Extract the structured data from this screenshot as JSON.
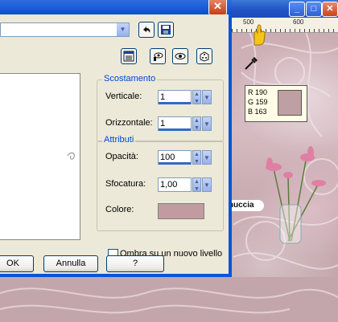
{
  "host": {
    "ruler_labels": [
      "500",
      "600"
    ],
    "color_readout": {
      "r": "R 190",
      "g": "G 159",
      "b": "B 163",
      "swatch": "#be9fa3"
    },
    "window_buttons": {
      "minimize": "_",
      "maximize": "□",
      "close": "✕"
    }
  },
  "dialog": {
    "close_glyph": "✕",
    "preset_value": "",
    "offset_group": {
      "title": "Scostamento",
      "vertical_label": "Verticale:",
      "vertical_value": "1",
      "horizontal_label": "Orizzontale:",
      "horizontal_value": "1"
    },
    "attributes_group": {
      "title": "Attributi",
      "opacity_label": "Opacità:",
      "opacity_value": "100",
      "blur_label": "Sfocatura:",
      "blur_value": "1,00",
      "color_label": "Colore:",
      "color_value": "#c29ba1"
    },
    "shadow_checkbox_label": "Ombra su un nuovo livello",
    "ok_label": "OK",
    "cancel_label": "Annulla",
    "help_label": "?"
  },
  "watermark": "Pinuccia"
}
